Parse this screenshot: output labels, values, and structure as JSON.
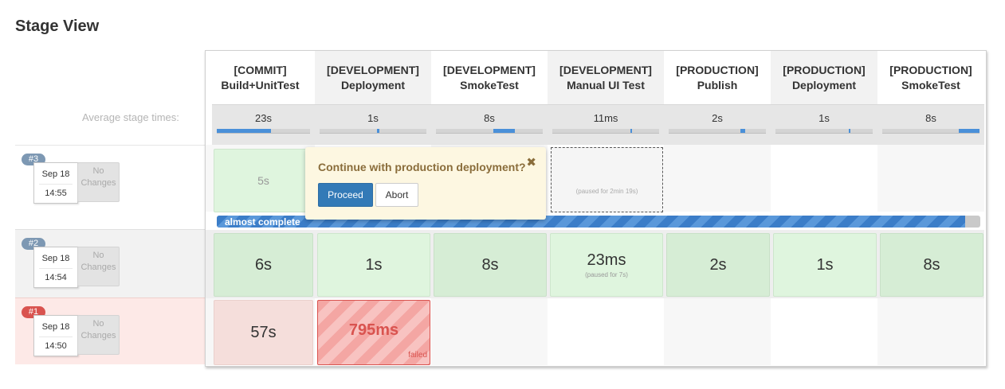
{
  "page": {
    "title": "Stage View"
  },
  "labels": {
    "average_stage_times": "Average stage times:"
  },
  "stages": [
    {
      "line1": "[COMMIT]",
      "line2": "Build+UnitTest",
      "avg": "23s",
      "avg_fill": [
        0.0,
        0.58
      ]
    },
    {
      "line1": "[DEVELOPMENT]",
      "line2": "Deployment",
      "avg": "1s",
      "avg_fill": [
        0.54,
        0.56
      ]
    },
    {
      "line1": "[DEVELOPMENT]",
      "line2": "SmokeTest",
      "avg": "8s",
      "avg_fill": [
        0.54,
        0.74
      ]
    },
    {
      "line1": "[DEVELOPMENT]",
      "line2": "Manual UI Test",
      "avg": "11ms",
      "avg_fill": [
        0.73,
        0.74
      ]
    },
    {
      "line1": "[PRODUCTION]",
      "line2": "Publish",
      "avg": "2s",
      "avg_fill": [
        0.74,
        0.79
      ]
    },
    {
      "line1": "[PRODUCTION]",
      "line2": "Deployment",
      "avg": "1s",
      "avg_fill": [
        0.75,
        0.77
      ]
    },
    {
      "line1": "[PRODUCTION]",
      "line2": "SmokeTest",
      "avg": "8s",
      "avg_fill": [
        0.79,
        1.0
      ]
    }
  ],
  "runs": [
    {
      "id": "#3",
      "date": "Sep 18",
      "time": "14:55",
      "changes": "No Changes",
      "cells": [
        "5s",
        "",
        "",
        "",
        "",
        "",
        ""
      ]
    },
    {
      "id": "#2",
      "date": "Sep 18",
      "time": "14:54",
      "changes": "No Changes",
      "cells": [
        "6s",
        "1s",
        "8s",
        "23ms",
        "2s",
        "1s",
        "8s"
      ]
    },
    {
      "id": "#1",
      "date": "Sep 18",
      "time": "14:50",
      "changes": "No Changes",
      "cells": [
        "57s",
        "795ms",
        "",
        "",
        "",
        "",
        ""
      ]
    }
  ],
  "run2_paused_note": "(paused for 7s)",
  "run3_paused_note": "(paused for 2min 19s)",
  "progress": {
    "label": "almost complete",
    "fraction": 0.98
  },
  "input_prompt": {
    "question": "Continue with production deployment?",
    "close": "✖",
    "proceed_label": "Proceed",
    "abort_label": "Abort"
  },
  "failed_label": "failed",
  "colors": {
    "accent": "#337ab7",
    "success": "#d6edd5",
    "failure": "#d9534f",
    "prompt": "#fdf7e1"
  }
}
